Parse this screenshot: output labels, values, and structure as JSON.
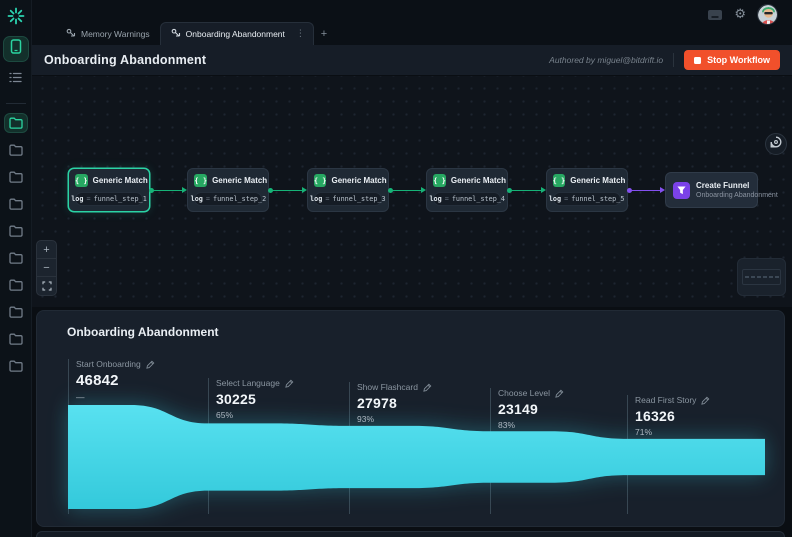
{
  "brand": {
    "logo_icon": "starburst-icon"
  },
  "rail": {
    "items": [
      {
        "icon": "phone-icon",
        "active": true
      },
      {
        "icon": "list-icon",
        "active": false
      }
    ],
    "folders": {
      "count": 10,
      "active_index": 0
    }
  },
  "tabs": {
    "items": [
      {
        "label": "Memory Warnings",
        "icon": "workflow-icon",
        "active": false
      },
      {
        "label": "Onboarding Abandonment",
        "icon": "workflow-icon",
        "active": true
      }
    ],
    "kebab_glyph": "⋮",
    "new_tab_label": "+"
  },
  "topbar_icons": {
    "console": "console-icon",
    "settings": "gear-icon",
    "avatar": "user-avatar"
  },
  "header": {
    "title": "Onboarding Abandonment",
    "authored_by": "Authored by miguel@bitdrift.io",
    "stop_button": {
      "label": "Stop Workflow",
      "color": "#f1502b"
    }
  },
  "canvas": {
    "zoom_in_label": "+",
    "zoom_out_label": "−",
    "nodes": [
      {
        "title": "Generic Match",
        "condition": {
          "field": "log",
          "operator": "=",
          "value": "funnel_step_1"
        },
        "selected": true
      },
      {
        "title": "Generic Match",
        "condition": {
          "field": "log",
          "operator": "=",
          "value": "funnel_step_2"
        },
        "selected": false
      },
      {
        "title": "Generic Match",
        "condition": {
          "field": "log",
          "operator": "=",
          "value": "funnel_step_3"
        },
        "selected": false
      },
      {
        "title": "Generic Match",
        "condition": {
          "field": "log",
          "operator": "=",
          "value": "funnel_step_4"
        },
        "selected": false
      },
      {
        "title": "Generic Match",
        "condition": {
          "field": "log",
          "operator": "=",
          "value": "funnel_step_5"
        },
        "selected": false
      }
    ],
    "output_node": {
      "title": "Create Funnel",
      "subtitle": "Onboarding Abandonment"
    },
    "connector_colors": {
      "match": "#16b377",
      "funnel": "#8450f0"
    },
    "node_icon_color": "#27a862",
    "output_icon_color": "#7b42e8"
  },
  "funnel_panel": {
    "title": "Onboarding Abandonment"
  },
  "chart_data": {
    "type": "area",
    "subtype": "centered-funnel",
    "title": "Onboarding Abandonment",
    "categories": [
      "Start Onboarding",
      "Select Language",
      "Show Flashcard",
      "Choose Level",
      "Read First Story"
    ],
    "values": [
      46842,
      30225,
      27978,
      23149,
      16326
    ],
    "conversion_pct": [
      null,
      65,
      93,
      83,
      71
    ],
    "first_step_pct_display": "—",
    "color": "#41d6e8",
    "gradient_top": "#58e1f0",
    "gradient_bottom": "#33c9db",
    "ylim": [
      0,
      46842
    ],
    "grid": false,
    "legend": false,
    "value_labels_shown": true
  }
}
